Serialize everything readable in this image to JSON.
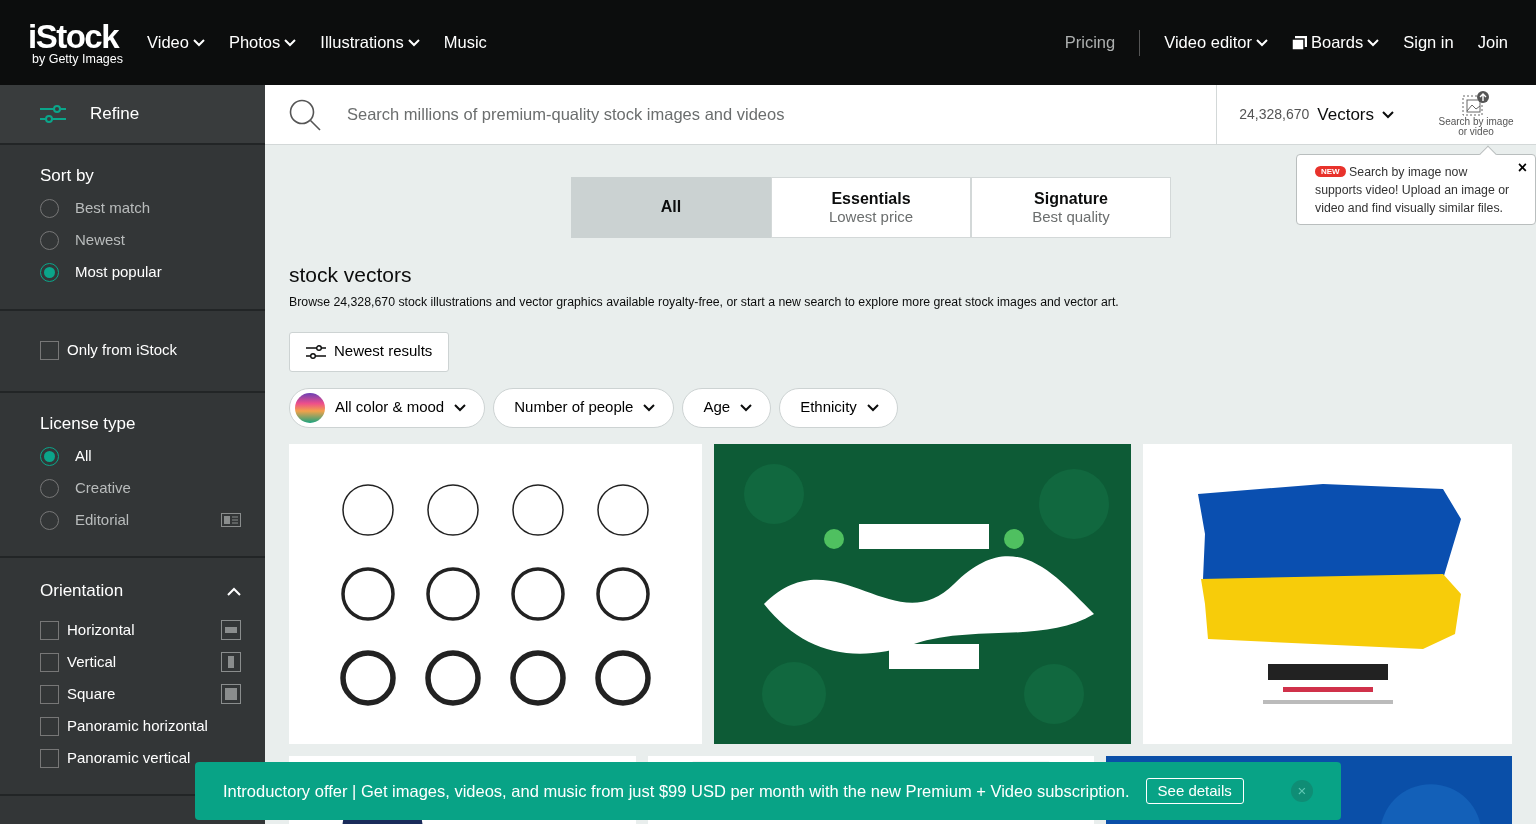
{
  "header": {
    "logo": {
      "name": "iStock",
      "tagline": "by Getty Images"
    },
    "nav": [
      {
        "label": "Video",
        "dropdown": true
      },
      {
        "label": "Photos",
        "dropdown": true
      },
      {
        "label": "Illustrations",
        "dropdown": true
      },
      {
        "label": "Music",
        "dropdown": false
      }
    ],
    "right": [
      {
        "label": "Pricing",
        "kind": "muted"
      },
      {
        "label": "Video editor",
        "kind": "dropdown"
      },
      {
        "label": "Boards",
        "kind": "boards"
      },
      {
        "label": "Sign in",
        "kind": "plain"
      },
      {
        "label": "Join",
        "kind": "plain"
      }
    ]
  },
  "sidebar": {
    "refine": "Refine",
    "sort_by": {
      "title": "Sort by",
      "options": [
        {
          "label": "Best match",
          "selected": false
        },
        {
          "label": "Newest",
          "selected": false
        },
        {
          "label": "Most popular",
          "selected": true
        }
      ]
    },
    "only_from_istock": {
      "label": "Only from iStock",
      "checked": false
    },
    "license_type": {
      "title": "License type",
      "options": [
        {
          "label": "All",
          "selected": true,
          "kind": "plain"
        },
        {
          "label": "Creative",
          "selected": false,
          "kind": "plain"
        },
        {
          "label": "Editorial",
          "selected": false,
          "kind": "editorial"
        }
      ]
    },
    "orientation": {
      "title": "Orientation",
      "expanded": true,
      "options": [
        {
          "label": "Horizontal",
          "checked": false,
          "kind": "horizontal"
        },
        {
          "label": "Vertical",
          "checked": false,
          "kind": "vertical"
        },
        {
          "label": "Square",
          "checked": false,
          "kind": "square"
        },
        {
          "label": "Panoramic horizontal",
          "checked": false,
          "kind": "none"
        },
        {
          "label": "Panoramic vertical",
          "checked": false,
          "kind": "none"
        }
      ]
    }
  },
  "search": {
    "placeholder": "Search millions of premium-quality stock images and videos",
    "count": "24,328,670",
    "asset_type": "Vectors",
    "search_by_image": "Search by image or video"
  },
  "tooltip": {
    "badge": "NEW",
    "text": "Search by image now supports video! Upload an image or video and find visually similar files.",
    "close": "×"
  },
  "tabs": [
    {
      "title": "All",
      "selected": true
    },
    {
      "title": "Essentials",
      "subtitle": "Lowest price",
      "selected": false
    },
    {
      "title": "Signature",
      "subtitle": "Best quality",
      "selected": false
    }
  ],
  "heading": "stock vectors",
  "description": "Browse 24,328,670 stock illustrations and vector graphics available royalty-free, or start a new search to explore more great stock images and vector art.",
  "newest_button": "Newest results",
  "filters": [
    {
      "label": "All color & mood",
      "kind": "color"
    },
    {
      "label": "Number of people",
      "kind": "plain"
    },
    {
      "label": "Age",
      "kind": "plain"
    },
    {
      "label": "Ethnicity",
      "kind": "plain"
    }
  ],
  "banner": {
    "text": "Introductory offer | Get images, videos, and music from just $99 USD per month with the new Premium + Video subscription.",
    "button": "See details",
    "close": "×"
  }
}
